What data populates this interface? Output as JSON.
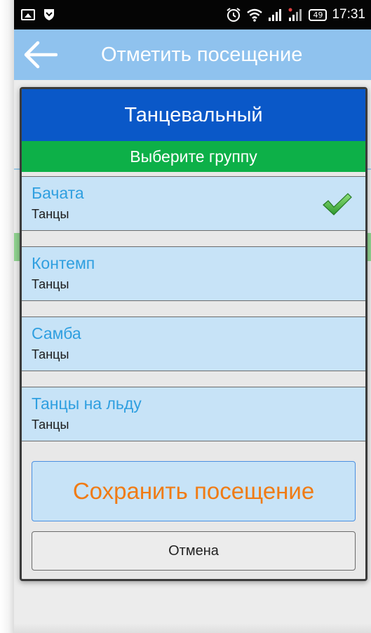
{
  "status_bar": {
    "time": "17:31",
    "battery": "49"
  },
  "app_bar": {
    "title": "Отметить посещение"
  },
  "dialog": {
    "title": "Танцевальный",
    "subtitle": "Выберите группу",
    "groups": [
      {
        "name": "Бачата",
        "category": "Танцы",
        "selected": true
      },
      {
        "name": "Контемп",
        "category": "Танцы",
        "selected": false
      },
      {
        "name": "Самба",
        "category": "Танцы",
        "selected": false
      },
      {
        "name": "Танцы на льду",
        "category": "Танцы",
        "selected": false
      }
    ],
    "save_label": "Сохранить посещение",
    "cancel_label": "Отмена"
  },
  "colors": {
    "app_bar": "#8fc2ee",
    "dialog_header": "#0a58c8",
    "dialog_subheader": "#0db048",
    "item_bg": "#c7e3f7",
    "item_name": "#2f9fe0",
    "save_text": "#f07b14"
  },
  "icons": {
    "back": "back-arrow-icon",
    "check": "check-icon"
  }
}
